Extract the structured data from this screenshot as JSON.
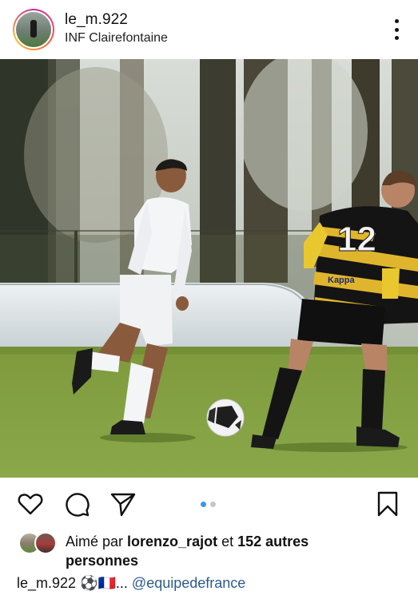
{
  "post": {
    "username": "le_m.922",
    "location": "INF Clairefontaine",
    "image_alt": "Football players on a grass pitch, one in white kit dribbling the ball, one in black and yellow striped kit number 12",
    "jersey_number": "12",
    "sponsor": "Kappa",
    "carousel": {
      "count": 2,
      "active_index": 0
    },
    "likes": {
      "prefix": "Aimé par",
      "liked_by": "lorenzo_rajot",
      "connector": "et",
      "others": "152 autres",
      "suffix": "personnes"
    },
    "caption": {
      "username": "le_m.922",
      "text": "⚽🇫🇷...",
      "mention": "@equipedefrance"
    }
  },
  "icons": {
    "more": "more-vertical-icon",
    "like": "heart-icon",
    "comment": "comment-icon",
    "share": "send-icon",
    "save": "bookmark-icon"
  },
  "colors": {
    "link": "#2d5b93",
    "dot_active": "#3897f0",
    "dot_inactive": "#c7c7c7",
    "text": "#111111"
  }
}
